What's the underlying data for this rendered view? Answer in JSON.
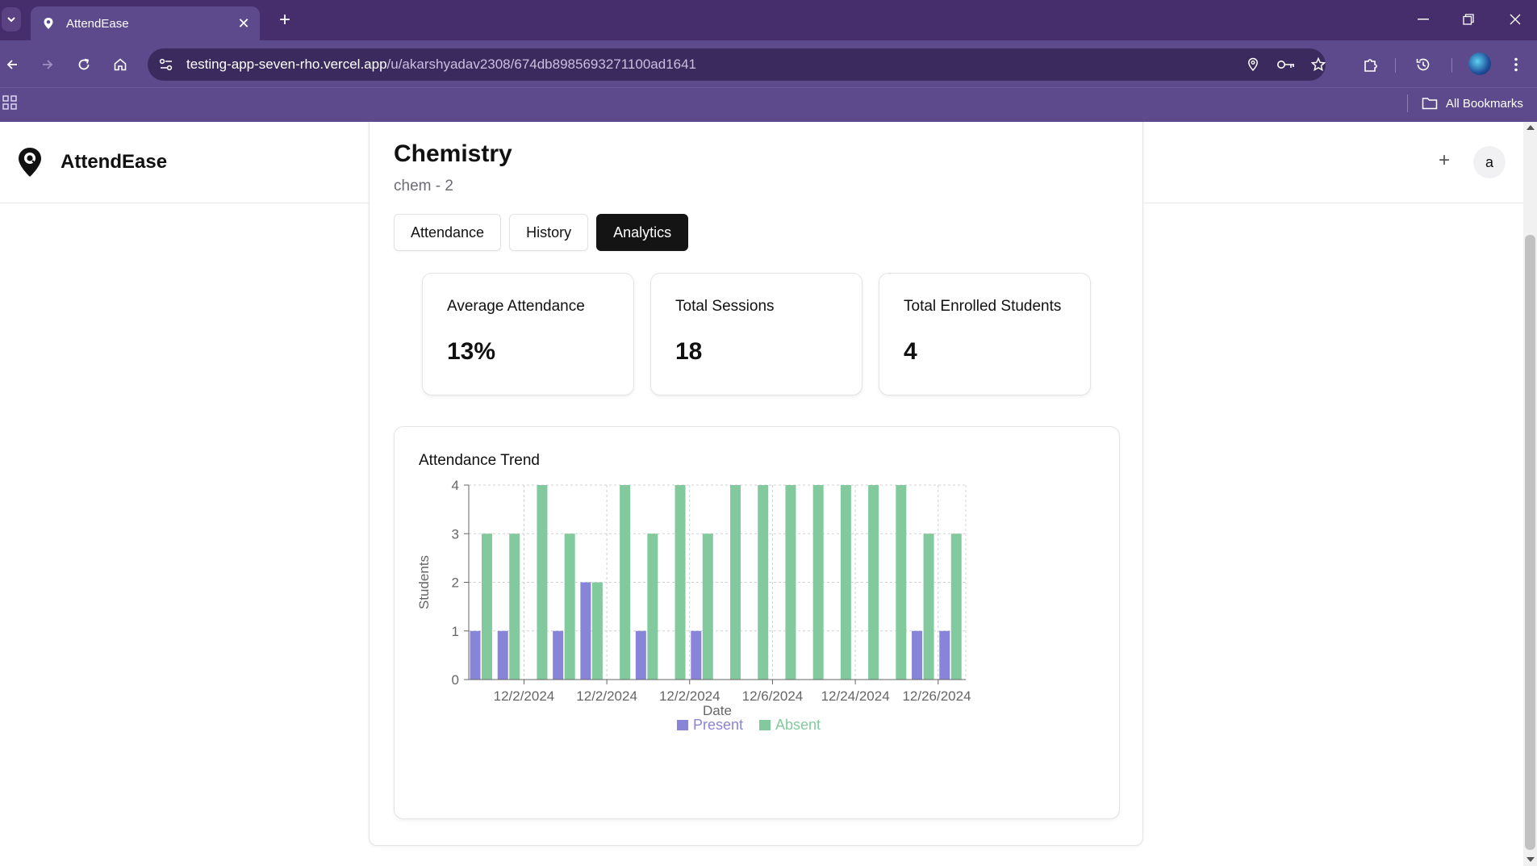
{
  "browser": {
    "tab_title": "AttendEase",
    "url_host": "testing-app-seven-rho.vercel.app",
    "url_path": "/u/akarshyadav2308/674db8985693271100ad1641",
    "bookmarks_label": "All Bookmarks"
  },
  "app": {
    "brand": "AttendEase",
    "avatar_letter": "a",
    "add_label": "+"
  },
  "class": {
    "title": "Chemistry",
    "subtitle": "chem - 2"
  },
  "tabs": [
    {
      "label": "Attendance",
      "active": false
    },
    {
      "label": "History",
      "active": false
    },
    {
      "label": "Analytics",
      "active": true
    }
  ],
  "stats": [
    {
      "label": "Average Attendance",
      "value": "13%"
    },
    {
      "label": "Total Sessions",
      "value": "18"
    },
    {
      "label": "Total Enrolled Students",
      "value": "4"
    }
  ],
  "colors": {
    "present": "#8884d8",
    "absent": "#82ca9d",
    "chrome": "#5d4a8c"
  },
  "chart_data": {
    "type": "bar",
    "title": "Attendance Trend",
    "xlabel": "Date",
    "ylabel": "Students",
    "ylim": [
      0,
      4
    ],
    "yticks": [
      0,
      1,
      2,
      3,
      4
    ],
    "grid": true,
    "legend": "bottom",
    "x_tick_labels": [
      "12/2/2024",
      "12/2/2024",
      "12/2/2024",
      "12/6/2024",
      "12/24/2024",
      "12/26/2024"
    ],
    "x_tick_after_index": [
      1,
      4,
      7,
      10,
      13,
      16
    ],
    "series": [
      {
        "name": "Present",
        "values": [
          1,
          1,
          0,
          1,
          2,
          0,
          1,
          0,
          1,
          0,
          0,
          0,
          0,
          0,
          0,
          0,
          1,
          1
        ]
      },
      {
        "name": "Absent",
        "values": [
          3,
          3,
          4,
          3,
          2,
          4,
          3,
          4,
          3,
          4,
          4,
          4,
          4,
          4,
          4,
          4,
          3,
          3
        ]
      }
    ]
  }
}
